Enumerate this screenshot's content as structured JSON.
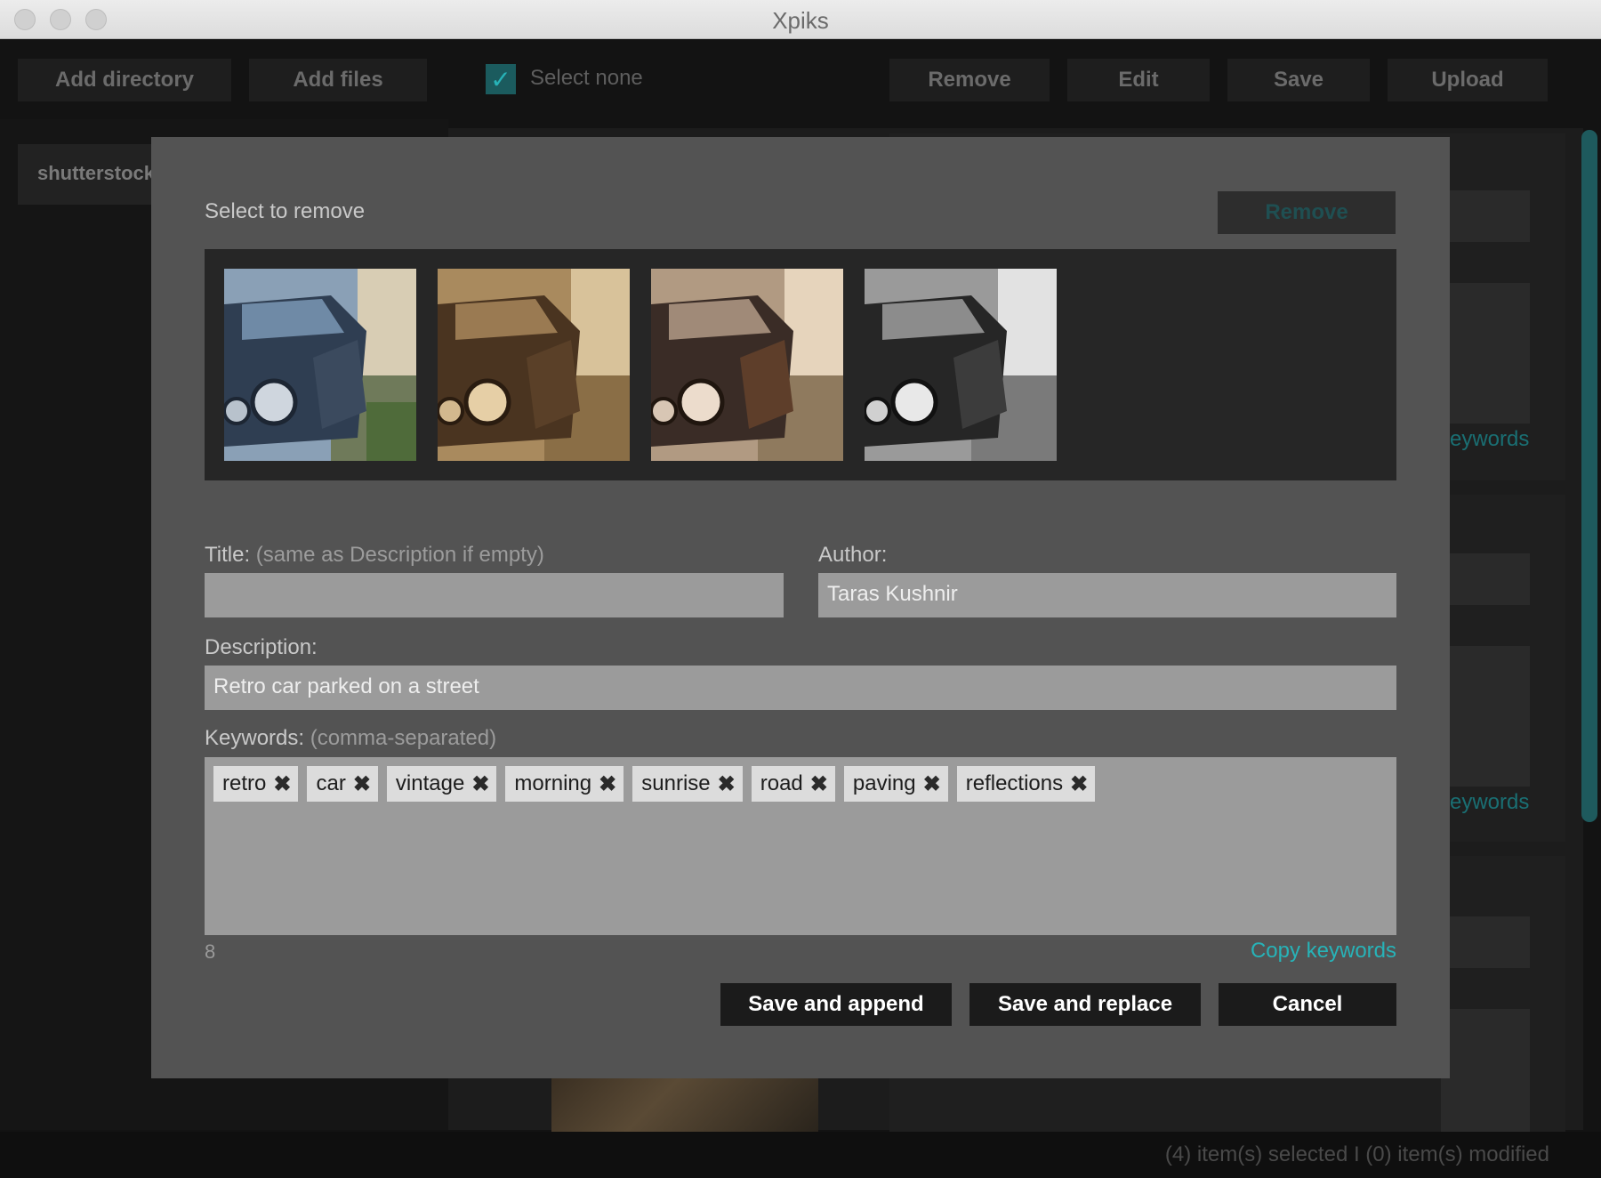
{
  "window": {
    "title": "Xpiks"
  },
  "toolbar": {
    "add_directory": "Add directory",
    "add_files": "Add files",
    "select_check": "✓",
    "select_none": "Select none",
    "remove": "Remove",
    "edit": "Edit",
    "save": "Save",
    "upload": "Upload"
  },
  "sidebar": {
    "items": [
      {
        "label": "shutterstock"
      }
    ]
  },
  "background": {
    "keywords_link_1": "eywords",
    "keywords_link_2": "eywords"
  },
  "statusbar": {
    "text": "(4) item(s) selected  I  (0) item(s) modified"
  },
  "dialog": {
    "select_to_remove": "Select to remove",
    "remove_button": "Remove",
    "thumbnails": [
      {
        "tone": "color"
      },
      {
        "tone": "sepia"
      },
      {
        "tone": "warm"
      },
      {
        "tone": "grayscale"
      }
    ],
    "title_label": "Title:",
    "title_hint": "(same as Description if empty)",
    "title_value": "",
    "author_label": "Author:",
    "author_value": "Taras Kushnir",
    "description_label": "Description:",
    "description_value": "Retro car parked on a street",
    "keywords_label": "Keywords:",
    "keywords_hint": "(comma-separated)",
    "keywords": [
      "retro",
      "car",
      "vintage",
      "morning",
      "sunrise",
      "road",
      "paving",
      "reflections"
    ],
    "keyword_remove_glyph": "✖",
    "keywords_count": "8",
    "copy_keywords": "Copy keywords",
    "save_and_append": "Save and append",
    "save_and_replace": "Save and replace",
    "cancel": "Cancel"
  },
  "colors": {
    "accent": "#27b3b8",
    "dialog_bg": "#535353",
    "field_bg": "#9b9b9b",
    "button_bg": "#1b1b1b"
  }
}
